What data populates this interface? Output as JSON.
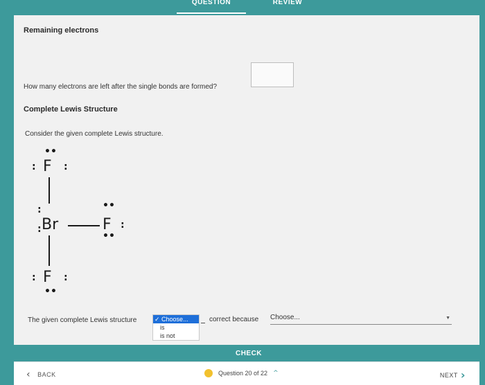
{
  "tabs": {
    "question": "QUESTION",
    "review": "REVIEW"
  },
  "section1": {
    "title": "Remaining electrons",
    "question": "How many electrons are left after the single bonds are formed?",
    "answer_value": ""
  },
  "section2": {
    "title": "Complete Lewis Structure",
    "instruction": "Consider the given complete Lewis structure."
  },
  "lewis": {
    "top_atom": "F",
    "center_atom": "Br",
    "right_atom": "F",
    "bottom_atom": "F",
    "lone_pair": ":",
    "pair_h": "••"
  },
  "statement": {
    "prefix": "The given complete Lewis structure",
    "dropdown_options": [
      "✓ Choose...",
      "is",
      "is not"
    ],
    "middle": "correct because",
    "second_select": "Choose...",
    "caret": "▼"
  },
  "buttons": {
    "check": "CHECK",
    "back": "BACK",
    "next": "NEXT"
  },
  "icons": {
    "back": "‹",
    "next": "›",
    "progress_up": "^"
  },
  "progress": {
    "label": "Question 20 of 22"
  },
  "colors": {
    "accent": "#3d9a9b",
    "progress_dot": "#f2c12e",
    "selected_option": "#1e6fd9"
  }
}
